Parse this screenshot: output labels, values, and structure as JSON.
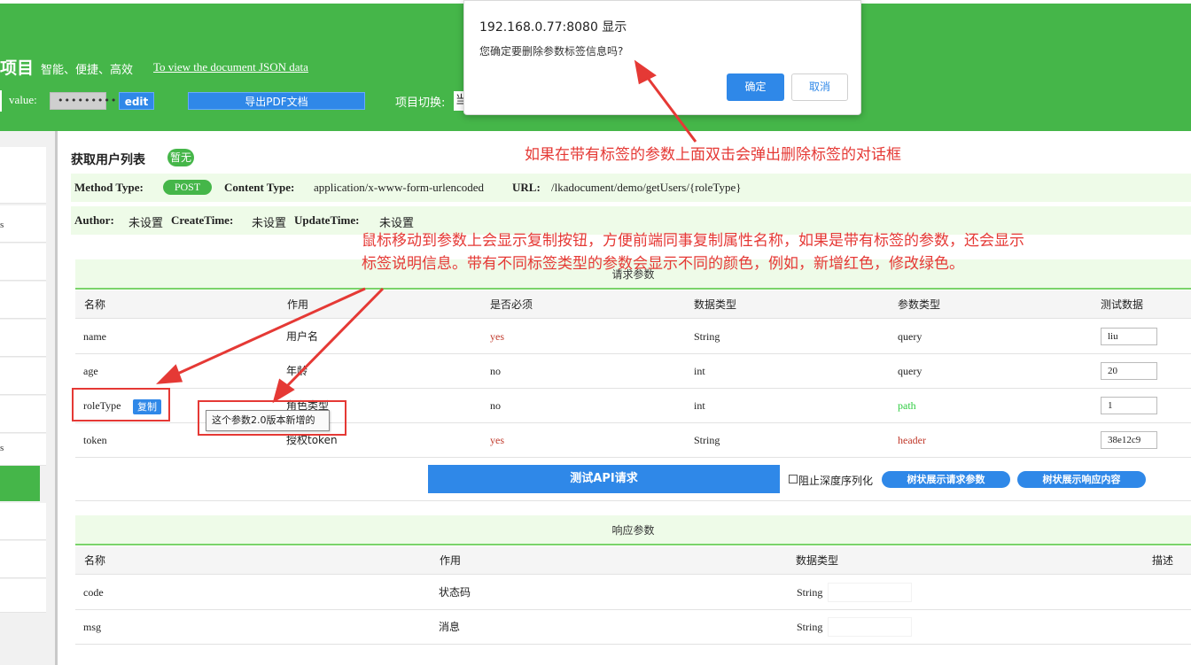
{
  "header": {
    "project_title": "项目",
    "slogan": "智能、便捷、高效",
    "doc_link": "To view the document JSON data",
    "value_label": "value:",
    "value_field": "•••••••••",
    "edit_label": "edit",
    "pdf_label": "导出PDF文档",
    "switch_label": "项目切换:",
    "switch_value": "当"
  },
  "dialog": {
    "title": "192.168.0.77:8080 显示",
    "message": "您确定要删除参数标签信息吗?",
    "ok_label": "确定",
    "cancel_label": "取消"
  },
  "sidebar": {
    "marks": [
      "s",
      "s"
    ]
  },
  "api": {
    "title": "获取用户列表",
    "tag": "暂无",
    "method_label": "Method Type:",
    "method": "POST",
    "content_type_label": "Content Type:",
    "content_type": "application/x-www-form-urlencoded",
    "url_label": "URL:",
    "url": "/lkadocument/demo/getUsers/{roleType}",
    "author_label": "Author:",
    "author": "未设置",
    "create_label": "CreateTime:",
    "create": "未设置",
    "update_label": "UpdateTime:",
    "update": "未设置"
  },
  "request": {
    "section_title": "请求参数",
    "columns": [
      "名称",
      "作用",
      "是否必须",
      "数据类型",
      "参数类型",
      "测试数据"
    ],
    "rows": [
      {
        "name": "name",
        "desc": "用户名",
        "required": "yes",
        "type": "String",
        "param_type": "query",
        "test": "liu"
      },
      {
        "name": "age",
        "desc": "年龄",
        "required": "no",
        "type": "int",
        "param_type": "query",
        "test": "20"
      },
      {
        "name": "roleType",
        "desc": "角色类型",
        "required": "no",
        "type": "int",
        "param_type": "path",
        "test": "1"
      },
      {
        "name": "token",
        "desc": "授权token",
        "required": "yes",
        "type": "String",
        "param_type": "header",
        "test": "38e12c9"
      }
    ],
    "copy_label": "复制",
    "tooltip": "这个参数2.0版本新增的",
    "test_button": "测试API请求",
    "deep_serialize_label": "阻止深度序列化",
    "tree_request_label": "树状展示请求参数",
    "tree_response_label": "树状展示响应内容"
  },
  "response": {
    "section_title": "响应参数",
    "columns": [
      "名称",
      "作用",
      "数据类型",
      "描述"
    ],
    "rows": [
      {
        "name": "code",
        "desc": "状态码",
        "type": "String"
      },
      {
        "name": "msg",
        "desc": "消息",
        "type": "String"
      }
    ]
  },
  "annotations": {
    "dialog_note": "如果在带有标签的参数上面双击会弹出删除标签的对话框",
    "copy_note_line1": "鼠标移动到参数上会显示复制按钮，方便前端同事复制属性名称，如果是带有标签的参数，还会显示",
    "copy_note_line2": "标签说明信息。带有不同标签类型的参数会显示不同的颜色，例如，新增红色，修改绿色。"
  },
  "colors": {
    "header_green": "#45b649",
    "accent_blue": "#2f88e8",
    "required_red": "#c0392b",
    "path_green": "#2ecc40",
    "annotation_red": "#e53935"
  }
}
